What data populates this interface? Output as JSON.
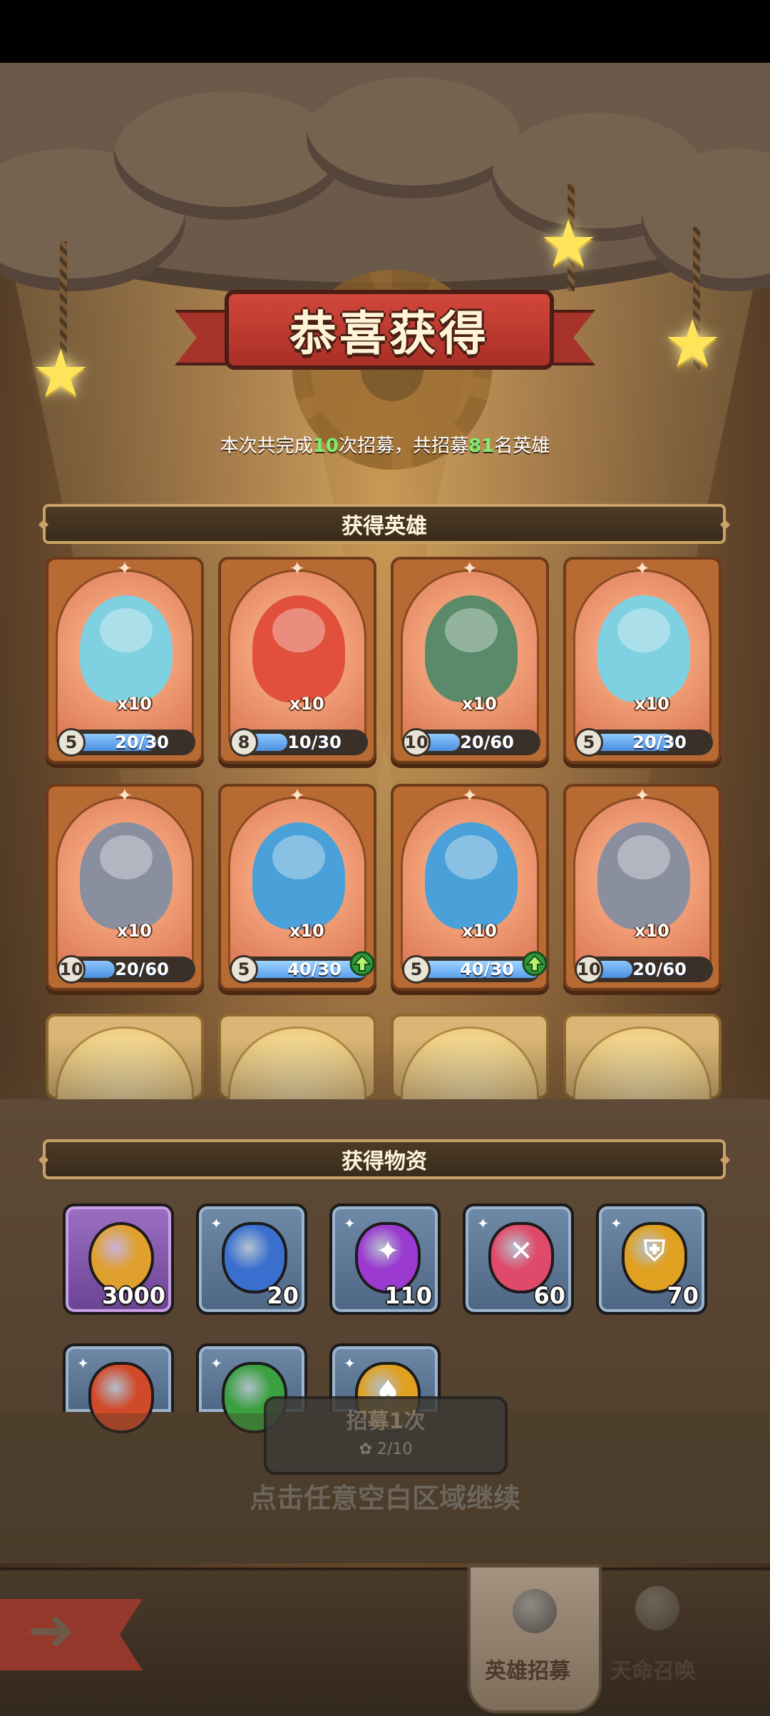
{
  "title": "恭喜获得",
  "summary": {
    "prefix": "本次共完成",
    "recruit_count": "10",
    "middle": "次招募，共招募",
    "total_heroes": "81",
    "suffix": "名英雄"
  },
  "sections": {
    "heroes": "获得英雄",
    "items": "获得物资"
  },
  "heroes": [
    {
      "count": "x10",
      "level": "5",
      "progress": "20/30",
      "ratio": 0.67,
      "upgradable": false,
      "color": "#7fd0e0"
    },
    {
      "count": "x10",
      "level": "8",
      "progress": "10/30",
      "ratio": 0.33,
      "upgradable": false,
      "color": "#e0503a"
    },
    {
      "count": "x10",
      "level": "10",
      "progress": "20/60",
      "ratio": 0.33,
      "upgradable": false,
      "color": "#5a8a6a"
    },
    {
      "count": "x10",
      "level": "5",
      "progress": "20/30",
      "ratio": 0.67,
      "upgradable": false,
      "color": "#7fd0e0"
    },
    {
      "count": "x10",
      "level": "10",
      "progress": "20/60",
      "ratio": 0.33,
      "upgradable": false,
      "color": "#8a8fa0"
    },
    {
      "count": "x10",
      "level": "5",
      "progress": "40/30",
      "ratio": 1.0,
      "upgradable": true,
      "color": "#4aa0d8"
    },
    {
      "count": "x10",
      "level": "5",
      "progress": "40/30",
      "ratio": 1.0,
      "upgradable": true,
      "color": "#4aa0d8"
    },
    {
      "count": "x10",
      "level": "10",
      "progress": "20/60",
      "ratio": 0.33,
      "upgradable": false,
      "color": "#8a8fa0"
    }
  ],
  "items": [
    {
      "qty": "3000",
      "icon": "gold-coin-icon",
      "glyph": "",
      "color": "#e0a030",
      "tile": "purple"
    },
    {
      "qty": "20",
      "icon": "blue-hat-stone-icon",
      "glyph": "",
      "color": "#3a6fd0",
      "tile": "blue"
    },
    {
      "qty": "110",
      "icon": "purple-shuriken-stone-icon",
      "glyph": "✦",
      "color": "#9a3ad0",
      "tile": "blue"
    },
    {
      "qty": "60",
      "icon": "red-cross-stone-icon",
      "glyph": "✕",
      "color": "#e04a6a",
      "tile": "blue"
    },
    {
      "qty": "70",
      "icon": "gold-shield-stone-icon",
      "glyph": "⛨",
      "color": "#e0a020",
      "tile": "blue"
    },
    {
      "qty": "",
      "icon": "red-sword-stone-icon",
      "glyph": "",
      "color": "#d04a2a",
      "tile": "blue"
    },
    {
      "qty": "",
      "icon": "green-bow-stone-icon",
      "glyph": "",
      "color": "#3aa040",
      "tile": "blue"
    },
    {
      "qty": "",
      "icon": "spade-coin-icon",
      "glyph": "♠",
      "color": "#e0a020",
      "tile": "blue"
    }
  ],
  "recruit_button": {
    "label": "招募1次",
    "cost": "2/10"
  },
  "continue_hint": "点击任意空白区域继续",
  "nav": {
    "tab_hero_recruit": "英雄招募",
    "tab_destiny_summon": "天命召唤"
  }
}
